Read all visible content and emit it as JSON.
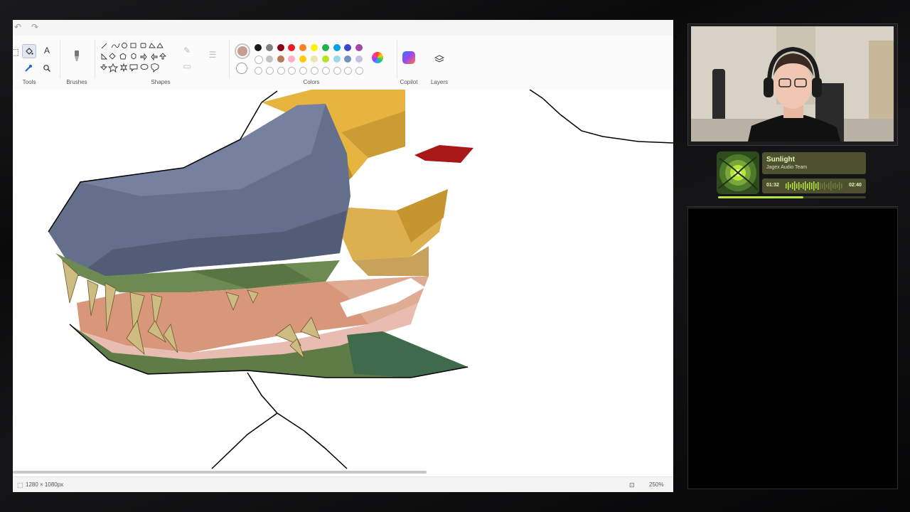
{
  "paint": {
    "ribbon": {
      "groups": {
        "tools": "Tools",
        "brushes": "Brushes",
        "shapes": "Shapes",
        "colors": "Colors",
        "copilot": "Copilot",
        "layers": "Layers"
      },
      "text_tool_glyph": "A",
      "current_color": "#c69c8e",
      "palette": [
        "#1a1a1a",
        "#7f7f7f",
        "#880015",
        "#ed1c24",
        "#ff7f27",
        "#fff200",
        "#22b14c",
        "#00a2e8",
        "#3f48cc",
        "#a349a4",
        "#ffffff",
        "#c3c3c3",
        "#b97a57",
        "#ffaec9",
        "#ffc90e",
        "#efe4b0",
        "#b5e61d",
        "#99d9ea",
        "#7092be",
        "#c8bfe7"
      ]
    },
    "status": {
      "canvas_size": "1280 × 1080px",
      "zoom": "250%"
    }
  },
  "music": {
    "song": "Sunlight",
    "artist": "Jagex Audio Team",
    "elapsed": "01:32",
    "total": "02:40",
    "progress": 0.575,
    "accent": "#b6e63c"
  }
}
